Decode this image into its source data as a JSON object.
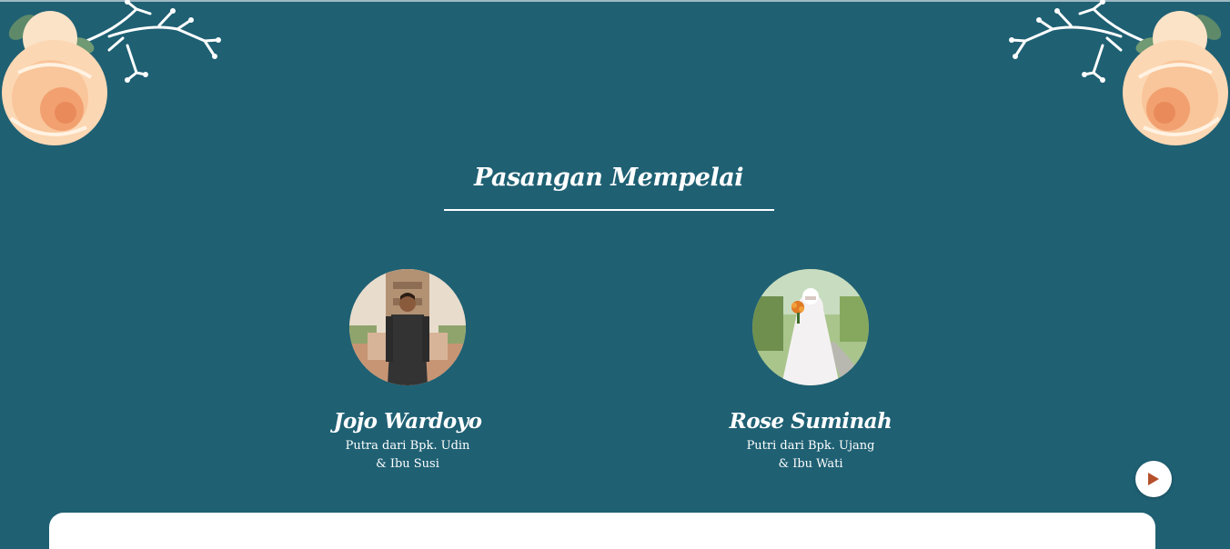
{
  "section": {
    "title": "Pasangan Mempelai"
  },
  "groom": {
    "name": "Jojo Wardoyo",
    "parents_line1": "Putra dari Bpk. Udin",
    "parents_line2": "& Ibu Susi"
  },
  "bride": {
    "name": "Rose Suminah",
    "parents_line1": "Putri dari Bpk. Ujang",
    "parents_line2": "& Ibu Wati"
  },
  "colors": {
    "background": "#1f6073",
    "text": "#ffffff",
    "play_icon": "#b5502a"
  },
  "icons": {
    "music": "play-icon"
  }
}
